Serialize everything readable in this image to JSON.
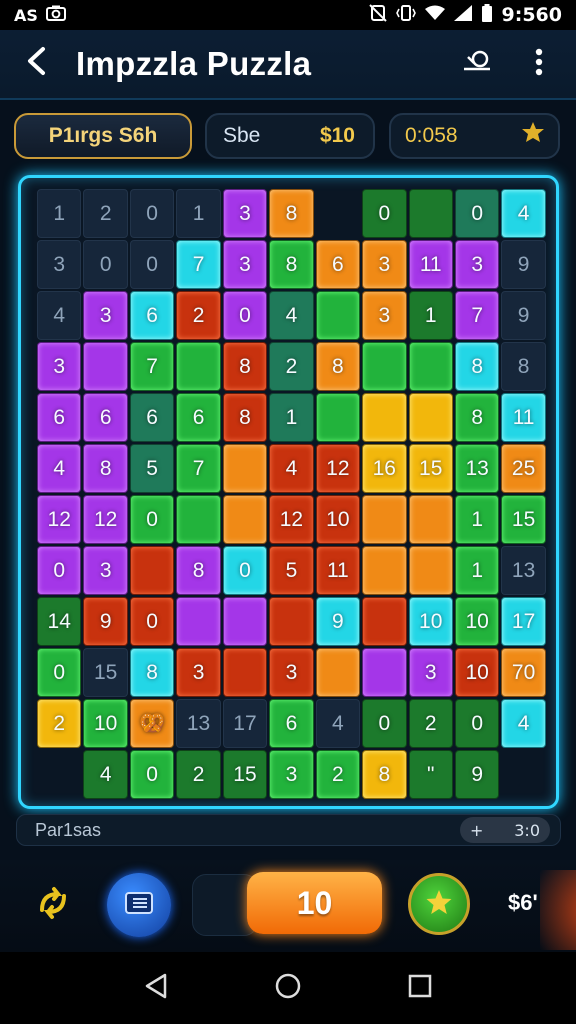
{
  "status": {
    "left_text": "AS",
    "time": "9:560"
  },
  "app": {
    "title": "Impzzla Puzzla"
  },
  "stats": {
    "player": "P1ırgs S6h",
    "score_label": "Sbe",
    "score_value": "$10",
    "time_value": "0:058"
  },
  "board": {
    "rows": [
      [
        [
          "1",
          "d"
        ],
        [
          "2",
          "d"
        ],
        [
          "0",
          "d"
        ],
        [
          "1",
          "d"
        ],
        [
          "3",
          "p"
        ],
        [
          "8",
          "o"
        ],
        [
          "",
          "e"
        ],
        [
          "0",
          "gd"
        ],
        [
          "",
          "gd"
        ],
        [
          "0",
          "t"
        ],
        [
          "4",
          "c"
        ]
      ],
      [
        [
          "3",
          "d"
        ],
        [
          "0",
          "d"
        ],
        [
          "0",
          "d"
        ],
        [
          "7",
          "c"
        ],
        [
          "3",
          "p"
        ],
        [
          "8",
          "g"
        ],
        [
          "6",
          "o"
        ],
        [
          "3",
          "o"
        ],
        [
          "11",
          "p"
        ],
        [
          "3",
          "p"
        ],
        [
          "9",
          "d"
        ]
      ],
      [
        [
          "4",
          "d"
        ],
        [
          "3",
          "p"
        ],
        [
          "6",
          "c"
        ],
        [
          "2",
          "r"
        ],
        [
          "0",
          "p"
        ],
        [
          "4",
          "t"
        ],
        [
          "",
          "g"
        ],
        [
          "3",
          "o"
        ],
        [
          "1",
          "gd"
        ],
        [
          "7",
          "p"
        ],
        [
          "9",
          "d"
        ]
      ],
      [
        [
          "3",
          "p"
        ],
        [
          "",
          "p"
        ],
        [
          "7",
          "g"
        ],
        [
          "",
          "g"
        ],
        [
          "8",
          "r"
        ],
        [
          "2",
          "t"
        ],
        [
          "8",
          "o"
        ],
        [
          "",
          "g"
        ],
        [
          "",
          "g"
        ],
        [
          "8",
          "c"
        ],
        [
          "8",
          "d"
        ]
      ],
      [
        [
          "6",
          "p"
        ],
        [
          "6",
          "p"
        ],
        [
          "6",
          "t"
        ],
        [
          "6",
          "g"
        ],
        [
          "8",
          "r"
        ],
        [
          "1",
          "t"
        ],
        [
          "",
          "g"
        ],
        [
          "",
          "y"
        ],
        [
          "",
          "y"
        ],
        [
          "8",
          "g"
        ],
        [
          "11",
          "c"
        ]
      ],
      [
        [
          "4",
          "p"
        ],
        [
          "8",
          "p"
        ],
        [
          "5",
          "t"
        ],
        [
          "7",
          "g"
        ],
        [
          "",
          "o"
        ],
        [
          "4",
          "r"
        ],
        [
          "12",
          "r"
        ],
        [
          "16",
          "y"
        ],
        [
          "15",
          "y"
        ],
        [
          "13",
          "g"
        ],
        [
          "25",
          "o"
        ]
      ],
      [
        [
          "12",
          "p"
        ],
        [
          "12",
          "p"
        ],
        [
          "0",
          "g"
        ],
        [
          "",
          "g"
        ],
        [
          "",
          "o"
        ],
        [
          "12",
          "r"
        ],
        [
          "10",
          "r"
        ],
        [
          "",
          "o"
        ],
        [
          "",
          "o"
        ],
        [
          "1",
          "g"
        ],
        [
          "15",
          "g"
        ]
      ],
      [
        [
          "0",
          "p"
        ],
        [
          "3",
          "p"
        ],
        [
          "",
          "r"
        ],
        [
          "8",
          "p"
        ],
        [
          "0",
          "c"
        ],
        [
          "5",
          "r"
        ],
        [
          "11",
          "r"
        ],
        [
          "",
          "o"
        ],
        [
          "",
          "o"
        ],
        [
          "1",
          "g"
        ],
        [
          "13",
          "d"
        ]
      ],
      [
        [
          "14",
          "gd"
        ],
        [
          "9",
          "r"
        ],
        [
          "0",
          "r"
        ],
        [
          "",
          "p"
        ],
        [
          "",
          "p"
        ],
        [
          "",
          "r"
        ],
        [
          "9",
          "c"
        ],
        [
          "",
          "r"
        ],
        [
          "10",
          "c"
        ],
        [
          "10",
          "g"
        ],
        [
          "17",
          "c"
        ]
      ],
      [
        [
          "0",
          "g"
        ],
        [
          "15",
          "d"
        ],
        [
          "8",
          "c"
        ],
        [
          "3",
          "r"
        ],
        [
          "",
          "r"
        ],
        [
          "3",
          "r"
        ],
        [
          "",
          "o"
        ],
        [
          "",
          "p"
        ],
        [
          "3",
          "p"
        ],
        [
          "10",
          "r"
        ],
        [
          "70",
          "o"
        ]
      ],
      [
        [
          "2",
          "y"
        ],
        [
          "10",
          "g"
        ],
        [
          "🥨",
          "o"
        ],
        [
          "13",
          "d"
        ],
        [
          "17",
          "d"
        ],
        [
          "6",
          "g"
        ],
        [
          "4",
          "d"
        ],
        [
          "0",
          "gd"
        ],
        [
          "2",
          "gd"
        ],
        [
          "0",
          "gd"
        ],
        [
          "4",
          "c"
        ]
      ],
      [
        [
          "",
          "e"
        ],
        [
          "4",
          "gd"
        ],
        [
          "0",
          "g"
        ],
        [
          "2",
          "gd"
        ],
        [
          "15",
          "gd"
        ],
        [
          "3",
          "g"
        ],
        [
          "2",
          "g"
        ],
        [
          "8",
          "y"
        ],
        [
          "\"",
          "gd"
        ],
        [
          "9",
          "gd"
        ],
        [
          "",
          "e"
        ]
      ]
    ]
  },
  "hint": {
    "label": "Par1sas",
    "plus": "+",
    "count": "3:0"
  },
  "controls": {
    "value": "10",
    "money": "$6'"
  },
  "icons": {
    "back": "back-arrow-icon",
    "search": "search-icon",
    "more": "more-vert-icon",
    "swap": "swap-icon",
    "menu": "grid-menu-icon",
    "star": "star-icon"
  },
  "colors": {
    "accent_cyan": "#30d6ff",
    "accent_orange": "#f16a06",
    "gold": "#c99a38",
    "purple": "#a436e8",
    "green": "#22b33c",
    "red": "#c8320e",
    "yellow": "#f2b70c"
  }
}
